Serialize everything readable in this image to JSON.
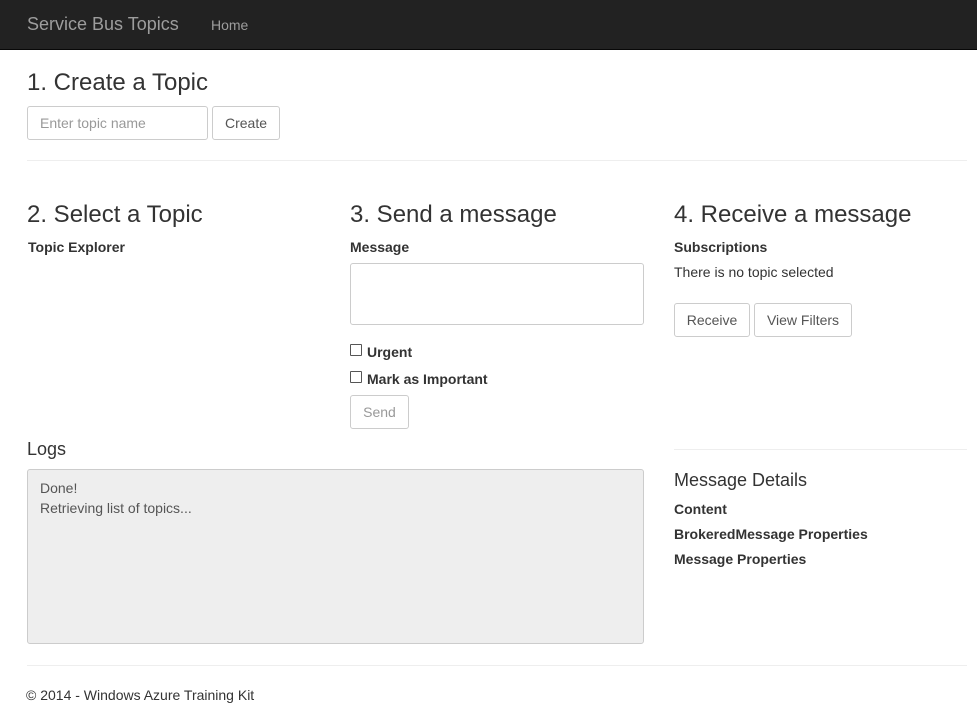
{
  "navbar": {
    "brand": "Service Bus Topics",
    "home": "Home"
  },
  "create": {
    "heading": "1. Create a Topic",
    "placeholder": "Enter topic name",
    "button": "Create"
  },
  "select": {
    "heading": "2. Select a Topic",
    "explorer_label": "Topic Explorer"
  },
  "send": {
    "heading": "3. Send a message",
    "message_label": "Message",
    "urgent_label": "Urgent",
    "important_label": "Mark as Important",
    "send_button": "Send"
  },
  "receive": {
    "heading": "4. Receive a message",
    "subscriptions_label": "Subscriptions",
    "status": "There is no topic selected",
    "receive_button": "Receive",
    "filters_button": "View Filters"
  },
  "logs": {
    "heading": "Logs",
    "lines": [
      "Done!",
      "Retrieving list of topics..."
    ]
  },
  "details": {
    "heading": "Message Details",
    "content": "Content",
    "brokered": "BrokeredMessage Properties",
    "properties": "Message Properties"
  },
  "footer": {
    "text": "© 2014 - Windows Azure Training Kit"
  }
}
